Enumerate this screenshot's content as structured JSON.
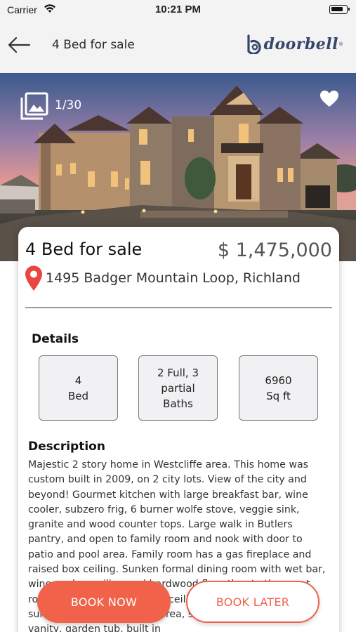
{
  "status_bar": {
    "carrier": "Carrier",
    "time": "10:21 PM"
  },
  "nav": {
    "title": "4 Bed for sale",
    "logo_text": "doorbell",
    "logo_mark": "®"
  },
  "gallery": {
    "count": "1/30"
  },
  "listing": {
    "title": "4 Bed for sale",
    "price": "$ 1,475,000",
    "address": "1495 Badger Mountain Loop, Richland"
  },
  "details": {
    "heading": "Details",
    "items": [
      {
        "value": "4",
        "label": "Bed"
      },
      {
        "value": "2 Full, 3 partial",
        "label": "Baths"
      },
      {
        "value": "6960",
        "label": "Sq ft"
      }
    ]
  },
  "description": {
    "heading": "Description",
    "text": "Majestic 2 story home in Westcliffe area. This home was custom built in 2009, on 2 city lots. View of the city and beyond! Gourmet kitchen with large breakfast bar, wine cooler, subzero frig, 6 burner wolfe stove, veggie sink, granite and wood counter tops. Large walk in Butlers pantry, and open to family room and nook with door to patio and pool area. Family room has a gas fireplace and raised box ceiling. Sunken formal dining room with wet bar, wine cooler, ceiling and hardwood floor thru to the great room with fireplace, 2 story ceiling and built ins. Master suite with balcony, sitting area, small wall fireplace, dual vanity, garden tub, built in"
  },
  "actions": {
    "book_now": "BOOK NOW",
    "book_later": "BOOK LATER"
  },
  "colors": {
    "accent": "#f0624a",
    "logo": "#36466a",
    "pin": "#e8463f"
  },
  "icons": [
    "wifi-icon",
    "battery-icon",
    "back-arrow-icon",
    "doorbell-logo",
    "gallery-icon",
    "heart-icon",
    "location-pin-icon"
  ]
}
